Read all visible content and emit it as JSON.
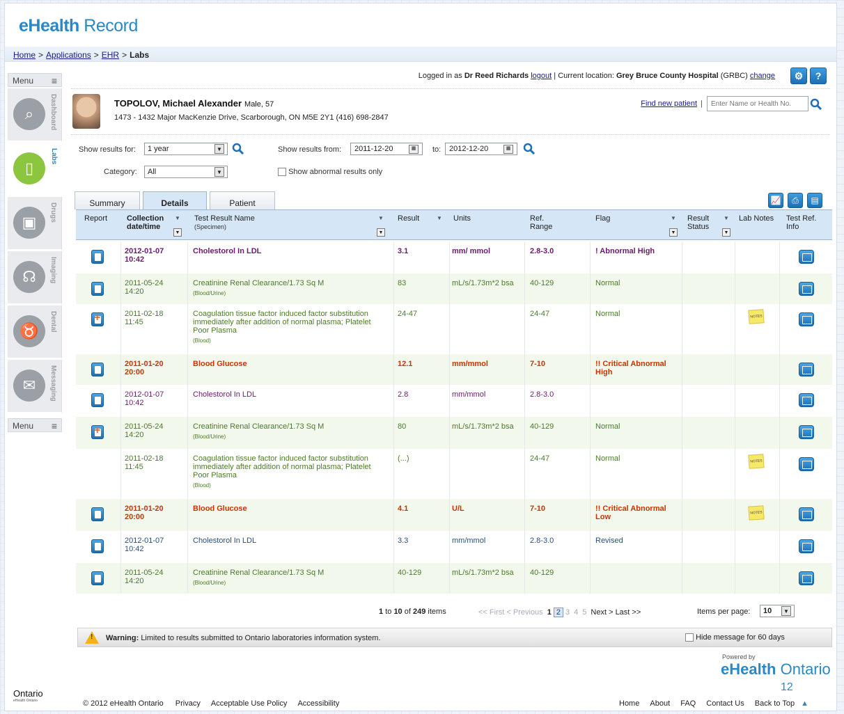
{
  "brand": {
    "e": "eHealth",
    "rest": "Record"
  },
  "breadcrumb": {
    "home": "Home",
    "sep": ">",
    "apps": "Applications",
    "ehr": "EHR",
    "current": "Labs"
  },
  "leftnav": {
    "menu_label": "Menu",
    "items": [
      {
        "label": "Dashboard",
        "icon": "dashboard-icon"
      },
      {
        "label": "Labs",
        "icon": "test-tube-icon"
      },
      {
        "label": "Drugs",
        "icon": "pill-bottle-icon"
      },
      {
        "label": "Imaging",
        "icon": "xray-icon"
      },
      {
        "label": "Dental",
        "icon": "tooth-icon"
      },
      {
        "label": "Messaging",
        "icon": "mouse-icon"
      }
    ]
  },
  "login": {
    "prefix": "Logged in as",
    "user": "Dr Reed Richards",
    "logout": "logout",
    "location_label": "| Current location:",
    "location": "Grey Bruce County Hospital",
    "code": "(GRBC)",
    "change": "change"
  },
  "patient": {
    "name": "TOPOLOV, Michael Alexander",
    "meta": "Male, 57",
    "address": "1473 - 1432 Major MacKenzie Drive, Scarborough, ON  M5E 2Y1  (416) 698-2847",
    "find": "Find new patient",
    "sep": "|",
    "search_placeholder": "Enter Name or Health No."
  },
  "filters": {
    "show_for_label": "Show results for:",
    "show_for_value": "1 year",
    "category_label": "Category:",
    "category_value": "All",
    "from_label": "Show results from:",
    "from_value": "2011-12-20",
    "to_label": "to:",
    "to_value": "2012-12-20",
    "abnormal_label": "Show abnormal results only"
  },
  "tabs": [
    "Summary",
    "Details",
    "Patient"
  ],
  "columns": {
    "report": "Report",
    "date": "Collection date/time",
    "name": "Test Result Name",
    "specimen": "(Specimen)",
    "result": "Result",
    "units": "Units",
    "ref": "Ref. Range",
    "flag": "Flag",
    "status": "Result Status",
    "notes": "Lab Notes",
    "info": "Test Ref. Info"
  },
  "rows": [
    {
      "report": "doc",
      "date": "2012-01-07",
      "time": "10:42",
      "name": "Cholestorol In LDL",
      "specimen": "",
      "result": "3.1",
      "units": "mm/ mmol",
      "ref": "2.8-3.0",
      "flag": "! Abnormal High",
      "notes": false,
      "style": "purple-bold"
    },
    {
      "report": "doc",
      "date": "2011-05-24",
      "time": "14:20",
      "name": "Creatinine Renal Clearance/1.73 Sq M",
      "specimen": "(Blood/Urine)",
      "result": "83",
      "units": "mL/s/1.73m*2 bsa",
      "ref": "40-129",
      "flag": "Normal",
      "notes": false,
      "style": "green"
    },
    {
      "report": "plus",
      "date": "2011-02-18",
      "time": "11:45",
      "name": "Coagulation tissue factor induced factor substitution immediately after addition of normal plasma; Platelet Poor Plasma",
      "specimen": "(Blood)",
      "result": "24-47",
      "units": "",
      "ref": "24-47",
      "flag": "Normal",
      "notes": true,
      "style": "green"
    },
    {
      "report": "doc",
      "date": "2011-01-20",
      "time": "20:00",
      "name": "Blood Glucose",
      "specimen": "",
      "result": "12.1",
      "units": "mm/mmol",
      "ref": "7-10",
      "flag": "!! Critical Abnormal High",
      "notes": false,
      "style": "red-bold"
    },
    {
      "report": "doc",
      "date": "2012-01-07",
      "time": "10:42",
      "name": "Cholestorol In LDL",
      "specimen": "",
      "result": "2.8",
      "units": "mm/mmol",
      "ref": "2.8-3.0",
      "flag": "",
      "notes": false,
      "style": "purple"
    },
    {
      "report": "plus",
      "date": "2011-05-24",
      "time": "14:20",
      "name": "Creatinine Renal Clearance/1.73 Sq M",
      "specimen": "(Blood/Urine)",
      "result": "80",
      "units": "mL/s/1.73m*2 bsa",
      "ref": "40-129",
      "flag": "Normal",
      "notes": false,
      "style": "green"
    },
    {
      "report": "none",
      "date": "2011-02-18",
      "time": "11:45",
      "name": "Coagulation tissue factor induced factor substitution immediately after addition of normal plasma; Platelet Poor Plasma",
      "specimen": "(Blood)",
      "result": "(...)",
      "units": "",
      "ref": "24-47",
      "flag": "Normal",
      "notes": true,
      "style": "green"
    },
    {
      "report": "doc",
      "date": "2011-01-20",
      "time": "20:00",
      "name": "Blood Glucose",
      "specimen": "",
      "result": "4.1",
      "units": "U/L",
      "ref": "7-10",
      "flag": "!! Critical Abnormal Low",
      "notes": true,
      "style": "red-bold"
    },
    {
      "report": "doc",
      "date": "2012-01-07",
      "time": "10:42",
      "name": "Cholestorol In LDL",
      "specimen": "",
      "result": "3.3",
      "units": "mm/mmol",
      "ref": "2.8-3.0",
      "flag": "Revised",
      "notes": false,
      "style": "blue"
    },
    {
      "report": "doc",
      "date": "2011-05-24",
      "time": "14:20",
      "name": "Creatinine Renal Clearance/1.73 Sq M",
      "specimen": "(Blood/Urine)",
      "result": "40-129",
      "units": "mL/s/1.73m*2 bsa",
      "ref": "40-129",
      "flag": "",
      "notes": false,
      "style": "green"
    }
  ],
  "notes_label": "NOTES",
  "pager": {
    "range_from": "1",
    "to": "to",
    "range_to": "10",
    "of": "of",
    "total": "249",
    "items": "items",
    "first": "<< First",
    "prev": "< Previous",
    "pages": [
      "1",
      "2",
      "3",
      "4",
      "5"
    ],
    "current": "2",
    "next": "Next >",
    "last": "Last >>",
    "per_page_label": "Items per page:",
    "per_page": "10"
  },
  "warning": {
    "label": "Warning:",
    "text": "Limited to results submitted to Ontario laboratories information system.",
    "hide": "Hide message for 60 days"
  },
  "powered": {
    "by": "Powered by",
    "e": "eHealth",
    "rest": "Ontario"
  },
  "slide_number": "12",
  "footer": {
    "logo": "Ontario",
    "logo_sub": "eHealth Ontario",
    "copyright": "© 2012 eHealth Ontario",
    "links": [
      "Privacy",
      "Acceptable Use Policy",
      "Accessibility"
    ],
    "right_links": [
      "Home",
      "About",
      "FAQ",
      "Contact Us",
      "Back to Top"
    ]
  }
}
